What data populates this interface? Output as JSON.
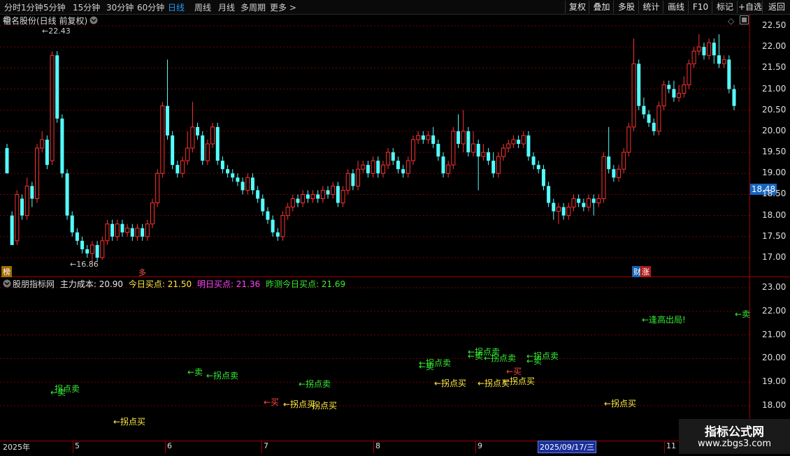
{
  "toolbar": {
    "periods": [
      "分时",
      "1分钟",
      "5分钟",
      "15分钟",
      "30分钟",
      "60分钟",
      "日线",
      "周线",
      "月线",
      "多周期",
      "更多 >"
    ],
    "active_period": "日线",
    "right_buttons": [
      "复权",
      "叠加",
      "多股",
      "统计",
      "画线",
      "F10",
      "标记",
      "+自选",
      "返回"
    ]
  },
  "main": {
    "stock_title": "祖名股份(日线 前复权)",
    "high_label": "22.43",
    "low_label": "16.86",
    "current_price": "18.48",
    "left_tag": "榜",
    "mid_tag": "多",
    "news_tag_1": "财",
    "news_tag_2": "涨",
    "y_ticks": [
      "22.50",
      "22.00",
      "21.50",
      "21.00",
      "20.50",
      "20.00",
      "19.50",
      "19.00",
      "18.50",
      "18.00",
      "17.50",
      "17.00"
    ]
  },
  "indicator": {
    "name": "股朋指标网",
    "cost_label": "主力成本: 20.90",
    "today_label": "今日买点: 21.50",
    "tomorrow_label": "明日买点: 21.36",
    "yesterday_label": "昨测今日买点: 21.69",
    "y_ticks": [
      "23.00",
      "22.00",
      "21.00",
      "20.00",
      "19.00",
      "18.00"
    ],
    "annotations": [
      {
        "text": "拐点卖",
        "color": "#33ee33",
        "x": 78,
        "y": 556
      },
      {
        "text": "←卖",
        "color": "#33ee33",
        "x": 72,
        "y": 561
      },
      {
        "text": "←拐点买",
        "color": "#ffee44",
        "x": 162,
        "y": 603
      },
      {
        "text": "←卖",
        "color": "#33ee33",
        "x": 268,
        "y": 532
      },
      {
        "text": "←拐点卖",
        "color": "#33ee33",
        "x": 295,
        "y": 537
      },
      {
        "text": "←买",
        "color": "#ff4444",
        "x": 377,
        "y": 575
      },
      {
        "text": "←拐点买",
        "color": "#ffee44",
        "x": 405,
        "y": 578
      },
      {
        "text": "拐点买",
        "color": "#ffee44",
        "x": 446,
        "y": 580
      },
      {
        "text": "←拐点卖",
        "color": "#33ee33",
        "x": 427,
        "y": 549
      },
      {
        "text": "←拐点卖",
        "color": "#33ee33",
        "x": 599,
        "y": 519
      },
      {
        "text": "←卖",
        "color": "#33ee33",
        "x": 599,
        "y": 524
      },
      {
        "text": "←拐点买",
        "color": "#ffee44",
        "x": 621,
        "y": 548
      },
      {
        "text": "←拐点卖",
        "color": "#33ee33",
        "x": 669,
        "y": 503
      },
      {
        "text": "←卖",
        "color": "#33ee33",
        "x": 669,
        "y": 509
      },
      {
        "text": "←拐点卖",
        "color": "#33ee33",
        "x": 692,
        "y": 512
      },
      {
        "text": "←拐点买",
        "color": "#ffee44",
        "x": 683,
        "y": 548
      },
      {
        "text": "←买",
        "color": "#ff4444",
        "x": 724,
        "y": 531
      },
      {
        "text": "←拐点买",
        "color": "#ffee44",
        "x": 719,
        "y": 545
      },
      {
        "text": "←拐点卖",
        "color": "#33ee33",
        "x": 753,
        "y": 509
      },
      {
        "text": "←卖",
        "color": "#33ee33",
        "x": 753,
        "y": 516
      },
      {
        "text": "←拐点买",
        "color": "#ffee44",
        "x": 864,
        "y": 577
      },
      {
        "text": "←逢高出局!",
        "color": "#33ee33",
        "x": 918,
        "y": 457
      },
      {
        "text": "←卖",
        "color": "#33ee33",
        "x": 1051,
        "y": 449
      }
    ]
  },
  "date_axis": {
    "labels": [
      {
        "text": "2025年",
        "x": 4
      },
      {
        "text": "5",
        "x": 107
      },
      {
        "text": "6",
        "x": 239
      },
      {
        "text": "7",
        "x": 377
      },
      {
        "text": "8",
        "x": 537
      },
      {
        "text": "9",
        "x": 683
      },
      {
        "text": "11",
        "x": 953
      }
    ],
    "highlight": "2025/09/17/三"
  },
  "watermark": {
    "line1": "指标公式网",
    "line2": "www.zbgs3.com"
  },
  "colors": {
    "up": "#ff3232",
    "down": "#54ffff",
    "grid": "#7a0000",
    "axis": "#a00000",
    "active": "#1e9bff"
  },
  "chart_data": {
    "type": "candlestick",
    "ylim": [
      16.7,
      22.7
    ],
    "candles": [
      [
        19.6,
        19.0,
        19.2,
        19.7
      ],
      [
        18.0,
        17.3,
        17.4,
        18.1
      ],
      [
        17.4,
        18.5,
        17.3,
        18.6
      ],
      [
        18.4,
        18.0,
        17.9,
        18.5
      ],
      [
        18.0,
        18.7,
        17.9,
        18.9
      ],
      [
        18.7,
        18.4,
        18.2,
        18.8
      ],
      [
        18.4,
        19.6,
        18.3,
        19.7
      ],
      [
        19.6,
        19.8,
        19.5,
        20.0
      ],
      [
        19.8,
        19.2,
        19.1,
        19.9
      ],
      [
        19.3,
        21.8,
        19.2,
        21.9
      ],
      [
        21.8,
        20.3,
        20.2,
        21.9
      ],
      [
        20.3,
        19.0,
        18.9,
        20.4
      ],
      [
        19.0,
        18.0,
        17.9,
        19.1
      ],
      [
        18.0,
        17.6,
        17.5,
        18.1
      ],
      [
        17.6,
        17.4,
        17.3,
        17.7
      ],
      [
        17.4,
        17.2,
        17.1,
        17.5
      ],
      [
        17.2,
        17.1,
        17.0,
        17.3
      ],
      [
        17.1,
        17.3,
        16.86,
        17.4
      ],
      [
        17.3,
        17.0,
        16.9,
        17.4
      ],
      [
        17.0,
        17.4,
        16.95,
        17.5
      ],
      [
        17.4,
        17.8,
        17.3,
        17.9
      ],
      [
        17.8,
        17.5,
        17.4,
        17.9
      ],
      [
        17.5,
        17.8,
        17.4,
        17.9
      ],
      [
        17.8,
        17.6,
        17.5,
        17.9
      ],
      [
        17.6,
        17.7,
        17.5,
        17.8
      ],
      [
        17.7,
        17.5,
        17.4,
        17.8
      ],
      [
        17.5,
        17.7,
        17.4,
        17.8
      ],
      [
        17.7,
        17.5,
        17.4,
        17.8
      ],
      [
        17.5,
        17.8,
        17.4,
        17.9
      ],
      [
        17.8,
        18.3,
        17.7,
        18.4
      ],
      [
        18.3,
        19.0,
        18.2,
        19.1
      ],
      [
        19.0,
        20.6,
        18.9,
        20.7
      ],
      [
        20.6,
        19.9,
        19.8,
        21.7
      ],
      [
        19.9,
        19.2,
        19.1,
        20.0
      ],
      [
        19.2,
        19.0,
        18.9,
        19.3
      ],
      [
        19.0,
        19.3,
        18.9,
        19.4
      ],
      [
        19.3,
        19.6,
        19.2,
        20.0
      ],
      [
        19.6,
        20.1,
        19.5,
        20.7
      ],
      [
        20.1,
        19.9,
        19.8,
        20.2
      ],
      [
        19.9,
        19.3,
        19.2,
        20.0
      ],
      [
        19.3,
        19.7,
        19.2,
        19.8
      ],
      [
        19.7,
        20.1,
        19.6,
        20.2
      ],
      [
        20.1,
        19.3,
        19.2,
        20.2
      ],
      [
        19.3,
        19.1,
        19.0,
        19.4
      ],
      [
        19.1,
        19.0,
        18.9,
        19.2
      ],
      [
        19.0,
        18.9,
        18.8,
        19.1
      ],
      [
        18.9,
        18.8,
        18.7,
        19.0
      ],
      [
        18.8,
        18.6,
        18.5,
        18.9
      ],
      [
        18.6,
        18.9,
        18.5,
        19.0
      ],
      [
        18.9,
        18.6,
        18.5,
        19.0
      ],
      [
        18.6,
        18.4,
        18.3,
        18.7
      ],
      [
        18.4,
        18.1,
        18.0,
        18.5
      ],
      [
        18.1,
        17.9,
        17.8,
        18.2
      ],
      [
        17.9,
        17.6,
        17.5,
        18.0
      ],
      [
        17.6,
        17.5,
        17.4,
        17.7
      ],
      [
        17.5,
        18.0,
        17.4,
        18.1
      ],
      [
        18.0,
        18.2,
        17.9,
        18.3
      ],
      [
        18.2,
        18.4,
        18.1,
        18.5
      ],
      [
        18.4,
        18.3,
        18.2,
        18.5
      ],
      [
        18.3,
        18.5,
        18.2,
        18.6
      ],
      [
        18.5,
        18.4,
        18.3,
        18.6
      ],
      [
        18.4,
        18.5,
        18.3,
        18.6
      ],
      [
        18.5,
        18.4,
        18.3,
        18.6
      ],
      [
        18.4,
        18.6,
        18.3,
        18.7
      ],
      [
        18.6,
        18.5,
        18.4,
        18.7
      ],
      [
        18.5,
        18.7,
        18.4,
        18.8
      ],
      [
        18.7,
        18.3,
        18.2,
        18.8
      ],
      [
        18.3,
        18.6,
        18.2,
        18.7
      ],
      [
        18.6,
        19.0,
        18.5,
        19.1
      ],
      [
        19.0,
        18.7,
        18.6,
        19.1
      ],
      [
        18.7,
        19.1,
        18.6,
        19.3
      ],
      [
        19.1,
        19.2,
        19.0,
        19.3
      ],
      [
        19.2,
        19.0,
        18.9,
        19.3
      ],
      [
        19.0,
        19.3,
        18.9,
        19.4
      ],
      [
        19.3,
        19.0,
        18.9,
        19.4
      ],
      [
        19.0,
        19.2,
        18.9,
        19.3
      ],
      [
        19.2,
        19.5,
        19.1,
        19.6
      ],
      [
        19.5,
        19.3,
        19.2,
        19.6
      ],
      [
        19.3,
        19.1,
        19.0,
        19.4
      ],
      [
        19.1,
        19.0,
        18.9,
        19.2
      ],
      [
        19.0,
        19.3,
        18.9,
        19.4
      ],
      [
        19.3,
        19.8,
        19.2,
        19.9
      ],
      [
        19.8,
        19.9,
        19.7,
        20.0
      ],
      [
        19.9,
        19.8,
        19.7,
        20.0
      ],
      [
        19.8,
        19.9,
        19.7,
        20.0
      ],
      [
        19.9,
        19.7,
        19.6,
        20.1
      ],
      [
        19.7,
        19.4,
        19.3,
        19.8
      ],
      [
        19.4,
        19.0,
        18.9,
        19.5
      ],
      [
        19.0,
        19.2,
        18.9,
        19.3
      ],
      [
        19.2,
        20.0,
        19.1,
        20.1
      ],
      [
        20.0,
        19.7,
        19.6,
        20.4
      ],
      [
        19.7,
        20.0,
        19.5,
        20.5
      ],
      [
        20.0,
        19.5,
        19.4,
        20.1
      ],
      [
        19.5,
        19.7,
        19.4,
        20.0
      ],
      [
        19.7,
        19.4,
        18.6,
        19.8
      ],
      [
        19.4,
        19.5,
        19.3,
        19.7
      ],
      [
        19.5,
        19.3,
        19.2,
        19.6
      ],
      [
        19.3,
        19.0,
        18.9,
        19.5
      ],
      [
        19.0,
        19.4,
        18.9,
        19.5
      ],
      [
        19.4,
        19.6,
        19.3,
        19.7
      ],
      [
        19.6,
        19.7,
        19.5,
        19.8
      ],
      [
        19.7,
        19.8,
        19.6,
        19.9
      ],
      [
        19.8,
        19.7,
        19.6,
        19.9
      ],
      [
        19.7,
        19.9,
        19.6,
        20.0
      ],
      [
        19.9,
        19.4,
        19.3,
        20.0
      ],
      [
        19.4,
        19.2,
        19.1,
        19.5
      ],
      [
        19.2,
        19.1,
        19.0,
        19.3
      ],
      [
        19.1,
        18.7,
        18.6,
        19.2
      ],
      [
        18.7,
        18.3,
        18.2,
        18.8
      ],
      [
        18.3,
        18.1,
        17.9,
        18.4
      ],
      [
        18.1,
        18.2,
        17.8,
        18.3
      ],
      [
        18.2,
        18.0,
        17.9,
        18.3
      ],
      [
        18.0,
        18.2,
        17.9,
        18.3
      ],
      [
        18.2,
        18.4,
        18.1,
        18.5
      ],
      [
        18.4,
        18.3,
        18.2,
        18.5
      ],
      [
        18.3,
        18.2,
        18.1,
        18.4
      ],
      [
        18.2,
        18.4,
        18.1,
        18.5
      ],
      [
        18.4,
        18.3,
        18.0,
        18.5
      ],
      [
        18.3,
        18.4,
        18.2,
        18.5
      ],
      [
        18.4,
        19.4,
        18.3,
        19.5
      ],
      [
        19.4,
        19.1,
        19.0,
        20.1
      ],
      [
        19.1,
        18.9,
        18.8,
        19.2
      ],
      [
        18.9,
        19.1,
        18.8,
        19.2
      ],
      [
        19.1,
        19.5,
        19.0,
        19.6
      ],
      [
        19.5,
        20.1,
        19.4,
        20.2
      ],
      [
        20.1,
        21.6,
        20.0,
        22.2
      ],
      [
        21.6,
        20.6,
        20.5,
        21.7
      ],
      [
        20.6,
        20.4,
        20.3,
        20.8
      ],
      [
        20.4,
        20.2,
        20.1,
        20.5
      ],
      [
        20.2,
        20.0,
        19.9,
        20.3
      ],
      [
        20.0,
        20.6,
        19.9,
        20.7
      ],
      [
        20.6,
        21.1,
        20.5,
        21.2
      ],
      [
        21.1,
        21.0,
        20.9,
        21.2
      ],
      [
        21.0,
        20.8,
        20.7,
        21.2
      ],
      [
        20.8,
        20.9,
        20.7,
        21.1
      ],
      [
        20.9,
        21.1,
        20.8,
        21.3
      ],
      [
        21.1,
        21.6,
        21.0,
        21.7
      ],
      [
        21.6,
        21.9,
        21.5,
        22.0
      ],
      [
        21.9,
        22.0,
        21.8,
        22.3
      ],
      [
        22.0,
        21.8,
        21.7,
        22.1
      ],
      [
        21.8,
        22.1,
        21.7,
        22.2
      ],
      [
        22.1,
        21.8,
        21.6,
        22.2
      ],
      [
        21.8,
        21.6,
        21.5,
        22.3
      ],
      [
        21.6,
        21.7,
        21.5,
        21.8
      ],
      [
        21.7,
        21.0,
        20.9,
        21.8
      ],
      [
        21.0,
        20.6,
        20.5,
        21.1
      ]
    ]
  }
}
